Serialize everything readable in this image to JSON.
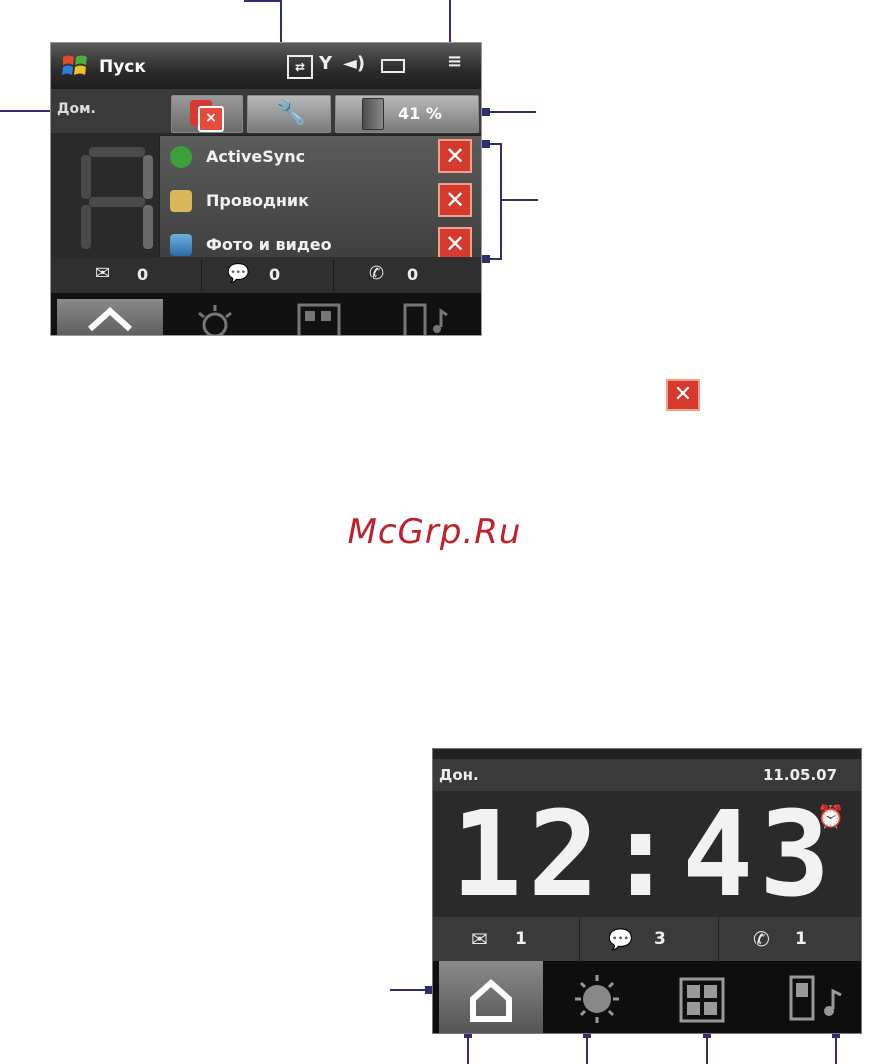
{
  "top_screen": {
    "start_label": "Пуск",
    "day_label": "Дом.",
    "battery_percent": "41 %",
    "menu_items": [
      {
        "label": "ActiveSync",
        "icon": "activesync-icon"
      },
      {
        "label": "Проводник",
        "icon": "explorer-icon"
      },
      {
        "label": "Фото и видео",
        "icon": "photos-icon"
      }
    ],
    "counts": [
      {
        "icon": "mail-icon",
        "value": "0"
      },
      {
        "icon": "sms-icon",
        "value": "0"
      },
      {
        "icon": "phone-icon",
        "value": "0"
      }
    ],
    "tabs": [
      "home-icon",
      "weather-icon",
      "launcher-icon",
      "music-icon"
    ]
  },
  "bottom_screen": {
    "day_label": "Дон.",
    "date": "11.05.07",
    "time": "12:43",
    "counts": [
      {
        "icon": "mail-icon",
        "value": "1"
      },
      {
        "icon": "sms-icon",
        "value": "3"
      },
      {
        "icon": "missed-call-icon",
        "value": "1"
      }
    ],
    "tabs": [
      "home-icon",
      "weather-icon",
      "launcher-icon",
      "music-icon"
    ]
  },
  "watermark": "McGrp.Ru",
  "colors": {
    "callout": "#2d2f6e",
    "close_red": "#d63a2f",
    "watermark": "#c0202a"
  }
}
